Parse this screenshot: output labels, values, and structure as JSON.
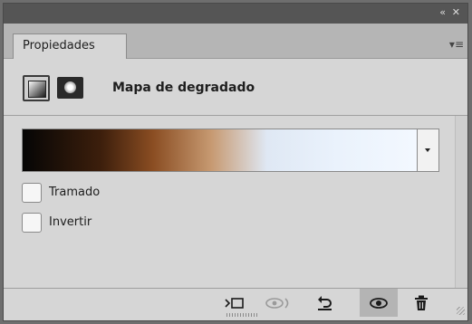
{
  "titlebar": {
    "collapse_icon": "double-chevron-icon",
    "close_icon": "close-icon"
  },
  "tabs": [
    {
      "label": "Propiedades"
    }
  ],
  "panel_menu_icon": "panel-menu-icon",
  "header": {
    "title": "Mapa de degradado",
    "adjustment_icon": "gradient-map-adjustment-icon",
    "mask_icon": "layer-mask-icon"
  },
  "gradient": {
    "colors": [
      "#050505",
      "#3d1f0c",
      "#8a4d22",
      "#c79a72",
      "#dfe8f4",
      "#eaf2fc",
      "#f3f8ff"
    ]
  },
  "options": [
    {
      "label": "Tramado",
      "checked": false
    },
    {
      "label": "Invertir",
      "checked": false
    }
  ],
  "footer": {
    "buttons": [
      {
        "icon": "clip-to-layer-icon"
      },
      {
        "icon": "view-previous-state-icon"
      },
      {
        "icon": "reset-icon"
      },
      {
        "icon": "toggle-visibility-icon"
      },
      {
        "icon": "trash-icon"
      }
    ]
  },
  "colors": {
    "panel_bg": "#d6d6d6",
    "tabstrip_bg": "#b5b5b5",
    "titlebar_bg": "#555555"
  }
}
